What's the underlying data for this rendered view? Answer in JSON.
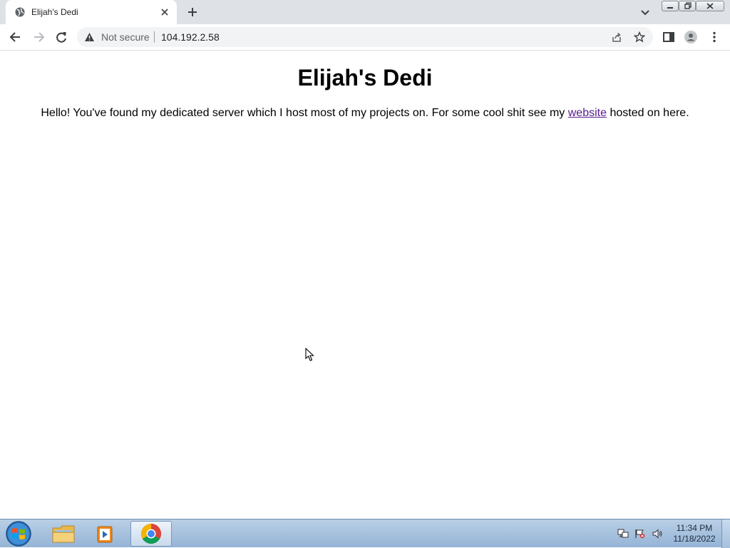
{
  "browser": {
    "tab": {
      "title": "Elijah's Dedi"
    },
    "omnibox": {
      "security_label": "Not secure",
      "url": "104.192.2.58"
    }
  },
  "page": {
    "heading": "Elijah's Dedi",
    "paragraph_before": "Hello! You've found my dedicated server which I host most of my projects on. For some cool shit see my ",
    "link_text": "website",
    "paragraph_after": " hosted on here."
  },
  "taskbar": {
    "clock_time": "11:34 PM",
    "clock_date": "11/18/2022"
  },
  "colors": {
    "link_visited": "#551a8b",
    "tabstrip_bg": "#dee1e6"
  },
  "icons": [
    "globe-icon",
    "close-icon",
    "plus-icon",
    "chevron-down-icon",
    "back-arrow-icon",
    "forward-arrow-icon",
    "reload-icon",
    "warning-icon",
    "share-icon",
    "star-icon",
    "side-panel-icon",
    "profile-icon",
    "kebab-menu-icon",
    "windows-start-icon",
    "folder-icon",
    "media-player-icon",
    "chrome-icon",
    "network-icon",
    "flag-icon",
    "speaker-icon"
  ]
}
